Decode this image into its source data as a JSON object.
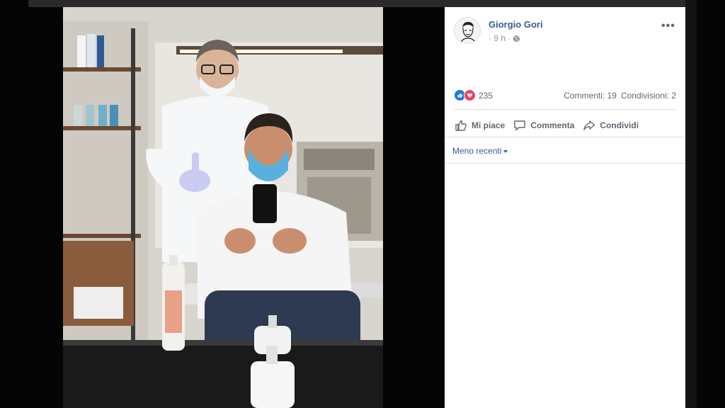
{
  "post": {
    "author": "Giorgio Gori",
    "time": "· 9 h ·",
    "more": "•••",
    "reaction_count": "235",
    "comments": "Commenti: 19",
    "shares": "Condivisioni: 2",
    "actions": {
      "like": "Mi piace",
      "comment": "Commenta",
      "share": "Condividi"
    },
    "sort": "Meno recenti",
    "icons": {
      "avatar": "avatar-drawing",
      "privacy": "globe-icon",
      "like_reaction": "like-reaction-icon",
      "love_reaction": "love-reaction-icon"
    }
  },
  "colors": {
    "link": "#385898",
    "muted": "#606770",
    "like": "#1877f2",
    "love": "#f33e58"
  }
}
